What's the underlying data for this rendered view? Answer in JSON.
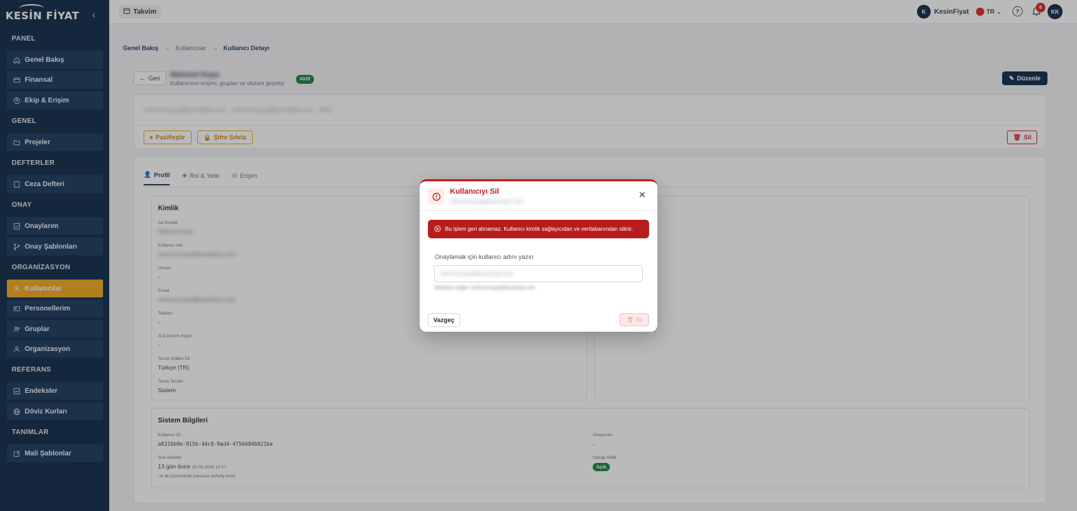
{
  "app": {
    "logo_text": "KESİN FİYAT"
  },
  "sidebar": {
    "sections": [
      {
        "title": "PANEL",
        "items": [
          {
            "label": "Genel Bakış",
            "icon": "home-icon"
          },
          {
            "label": "Finansal",
            "icon": "wallet-icon"
          },
          {
            "label": "Ekip & Erişim",
            "icon": "shield-icon"
          }
        ]
      },
      {
        "title": "GENEL",
        "items": [
          {
            "label": "Projeler",
            "icon": "folder-icon"
          }
        ]
      },
      {
        "title": "DEFTERLER",
        "items": [
          {
            "label": "Ceza Defteri",
            "icon": "book-icon"
          }
        ]
      },
      {
        "title": "ONAY",
        "items": [
          {
            "label": "Onaylarım",
            "icon": "check-square-icon"
          },
          {
            "label": "Onay Şablonları",
            "icon": "git-branch-icon"
          }
        ]
      },
      {
        "title": "ORGANİZASYON",
        "items": [
          {
            "label": "Kullanıcılar",
            "icon": "user-icon",
            "active": true
          },
          {
            "label": "Personellerim",
            "icon": "id-card-icon"
          },
          {
            "label": "Gruplar",
            "icon": "users-icon"
          },
          {
            "label": "Organizasyon",
            "icon": "user-icon"
          }
        ]
      },
      {
        "title": "REFERANS",
        "items": [
          {
            "label": "Endeksler",
            "icon": "chart-icon"
          },
          {
            "label": "Döviz Kurları",
            "icon": "globe-icon"
          }
        ]
      },
      {
        "title": "TANIMLAR",
        "items": [
          {
            "label": "Mali Şablonlar",
            "icon": "edit-icon"
          }
        ]
      }
    ]
  },
  "topbar": {
    "calendar_label": "Takvim",
    "org_avatar": "K",
    "org_name": "KesinFiyat",
    "lang": "TR",
    "notification_count": "6",
    "user_initials": "KK"
  },
  "breadcrumb": {
    "home": "Genel Bakış",
    "parent": "Kullanıcılar",
    "current": "Kullanıcı Detayı"
  },
  "header": {
    "back_label": "Geri",
    "user_name": "Mehmet Kaya",
    "subtitle": "Kullanıcının erişimi, grupları ve oturum geçmişi",
    "status": "Aktif",
    "edit_label": "Düzenle"
  },
  "top_panel": {
    "email_line": "mehmet.kaya@kesinfiyat.com · mehmet.kaya@kesinfiyat.com · Aktif",
    "deactivate_label": "Pasifleştir",
    "reset_password_label": "Şifre Sıfırla",
    "delete_label": "Sil"
  },
  "tabs": [
    {
      "label": "Profil",
      "active": true
    },
    {
      "label": "Rol & Yetki"
    },
    {
      "label": "Erişim"
    }
  ],
  "identity": {
    "title": "Kimlik",
    "fields": [
      {
        "label": "Ad Soyad",
        "value": "Mehmet Kaya",
        "blur": true
      },
      {
        "label": "Kullanıcı Adı",
        "value": "mehmet.kaya@kesinfiyat.com",
        "blur": true
      },
      {
        "label": "Unvan",
        "value": "-"
      },
      {
        "label": "Email",
        "value": "mehmet.kaya@kesinfiyat.com",
        "blur": true
      },
      {
        "label": "Telefon",
        "value": "-"
      },
      {
        "label": "Acil Durum Kişisi",
        "value": "-"
      },
      {
        "label": "Tercih Edilen Dil",
        "value": "Türkçe (TR)"
      },
      {
        "label": "Tema Tercihi",
        "value": "Sistem"
      }
    ]
  },
  "system": {
    "title": "Sistem Bilgileri",
    "user_id_label": "Kullanıcı ID",
    "user_id": "a8316b9e-915b-44c8-9ad4-4750484b821ba",
    "last_activity_label": "Son Aktivite",
    "last_activity": "13 gün önce",
    "last_activity_date": "15.09.2026 15:27",
    "last_activity_note": "~6 dk çözünürlük (session activity lock)",
    "created_by_label": "Oluşturan",
    "created_by": "-",
    "account_lock_label": "Hesap Kilidi",
    "account_lock": "Açık"
  },
  "modal": {
    "title": "Kullanıcıyı Sil",
    "subtitle": "mehmet.kaya@kesinfiyat.com",
    "warning": "Bu işlem geri alınamaz. Kullanıcı kimlik sağlayıcıdan ve veritabanından silinir.",
    "confirm_label": "Onaylamak için kullanıcı adını yazın",
    "confirm_placeholder": "mehmet.kaya@kesinfiyat.com",
    "hint": "Beklenen değer: mehmet.kaya@kesinfiyat.com",
    "cancel_label": "Vazgeç",
    "delete_label": "Sil"
  },
  "colors": {
    "sidebar_bg": "#0c2748",
    "accent": "#f2a91c",
    "danger": "#b91c1c",
    "success": "#15803d"
  }
}
